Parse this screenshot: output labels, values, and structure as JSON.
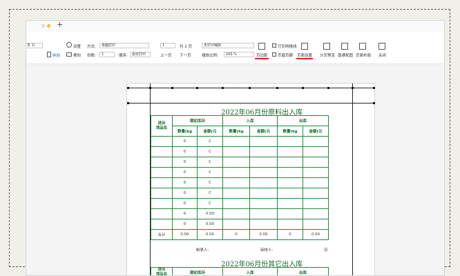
{
  "tab_bar": {
    "plus_label": "+"
  },
  "ribbon": {
    "font_select": "本 1)",
    "settings_label": "设置",
    "mode_label": "方式:",
    "mode_value": "单面打印",
    "page_value": "1",
    "page_total": "共 2 页",
    "scale_select": "无打印缩放",
    "print_gridlines": "打印网格线",
    "landscape_label": "纵向",
    "portrait_label": "横向",
    "copies_label": "份数:",
    "copies_value": "1",
    "order_label": "顺序:",
    "order_value": "逐份打印",
    "prev_page": "上一页",
    "next_page": "下一页",
    "zoom_label": "缩放比例:",
    "zoom_value": "100 %",
    "margins_btn": "页边距",
    "header_footer_btn": "页眉页脚",
    "page_setup_btn": "页面设置",
    "page_break_btn": "分页预览",
    "normal_view_btn": "普通视图",
    "page_layout_btn": "页面布局",
    "close_btn": "关闭"
  },
  "sheet": {
    "title1": "2022年06月份原料出入库",
    "title2": "2022年06月份其它出入库",
    "col_item": "进出\n项品名",
    "group_opening": "期初库存",
    "group_in": "入库",
    "group_out": "出库",
    "qty": "数量(kg",
    "amount": "金额(元",
    "rows": [
      {
        "q": "0",
        "a": "C"
      },
      {
        "q": "0",
        "a": "C"
      },
      {
        "q": "0",
        "a": "C"
      },
      {
        "q": "0",
        "a": "C"
      },
      {
        "q": "0",
        "a": "C"
      },
      {
        "q": "0",
        "a": "C"
      },
      {
        "q": "0",
        "a": "C"
      },
      {
        "q": "0",
        "a": "0.00"
      },
      {
        "q": "0",
        "a": "0.00"
      }
    ],
    "total_label": "合计",
    "total_values": [
      "0.00",
      "0.00",
      "0",
      "0.00",
      "0",
      "0.00"
    ],
    "sign_maker": "制表人:",
    "sign_reviewer": "审核人:",
    "sign_date": "日"
  }
}
